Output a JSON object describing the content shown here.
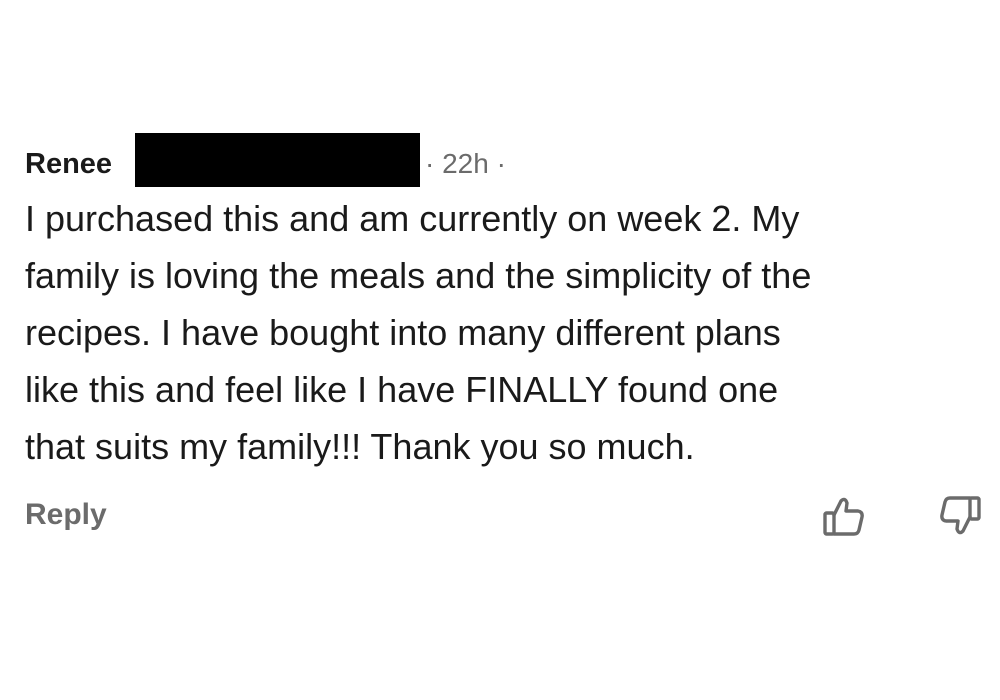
{
  "comment": {
    "author": "Renee",
    "author_redacted": true,
    "timestamp": "22h",
    "meta_separator": "·",
    "body": "I purchased this and am currently on week 2. My\nfamily is loving the meals and the simplicity of the\nrecipes. I have bought into many different plans\nlike this and feel like I have FINALLY found one\nthat suits my family!!!  Thank you so much.",
    "reply_label": "Reply",
    "icons": {
      "upvote": "thumbs-up-icon",
      "downvote": "thumbs-down-icon"
    }
  }
}
